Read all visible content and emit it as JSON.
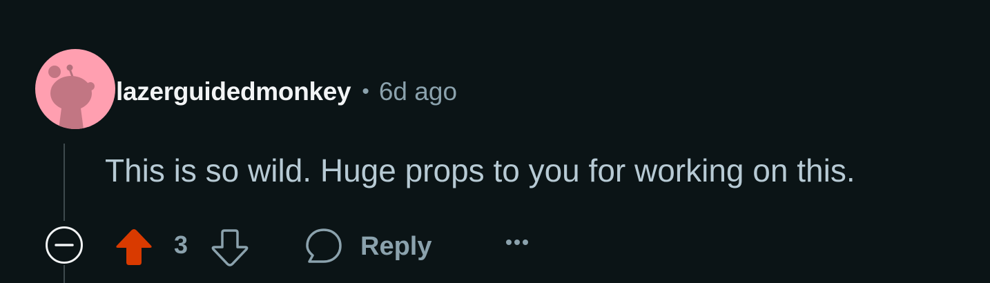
{
  "comment": {
    "author": "lazerguidedmonkey",
    "separator": "•",
    "timestamp": "6d ago",
    "body": "This is so wild. Huge props to you for working on this.",
    "score": "3"
  },
  "actions": {
    "collapse_icon": "collapse-minus-icon",
    "upvote_icon": "upvote-arrow-icon",
    "downvote_icon": "downvote-arrow-icon",
    "reply_icon": "speech-bubble-icon",
    "reply_label": "Reply",
    "more_icon": "ellipsis-icon"
  },
  "colors": {
    "background": "#0b1416",
    "avatar_bg": "#ff9fb0",
    "upvote_active": "#d93a00",
    "username": "#f2f4f5",
    "muted": "#8ba2ad",
    "body_text": "#b7cad4"
  }
}
